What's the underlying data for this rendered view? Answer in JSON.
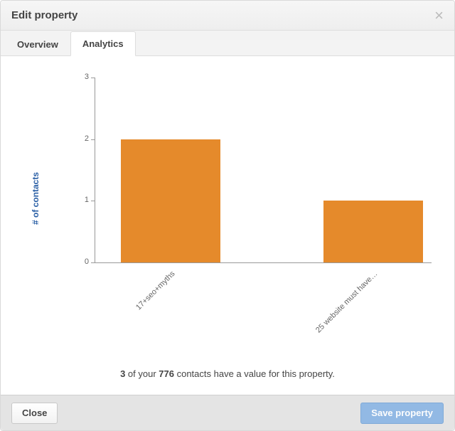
{
  "modal": {
    "title": "Edit property",
    "close_glyph": "×"
  },
  "tabs": [
    {
      "label": "Overview",
      "active": false
    },
    {
      "label": "Analytics",
      "active": true
    }
  ],
  "chart_data": {
    "type": "bar",
    "categories": [
      "17+seo+myths",
      "25 website must have…"
    ],
    "values": [
      2,
      1
    ],
    "ylabel": "# of contacts",
    "xlabel": "",
    "ylim": [
      0,
      3
    ],
    "yticks": [
      0,
      1,
      2,
      3
    ],
    "bar_color": "#e58a2b"
  },
  "summary": {
    "count_with_value": "3",
    "mid_1": " of your ",
    "total_contacts": "776",
    "mid_2": " contacts have a value for this property."
  },
  "footer": {
    "close_label": "Close",
    "save_label": "Save property"
  }
}
